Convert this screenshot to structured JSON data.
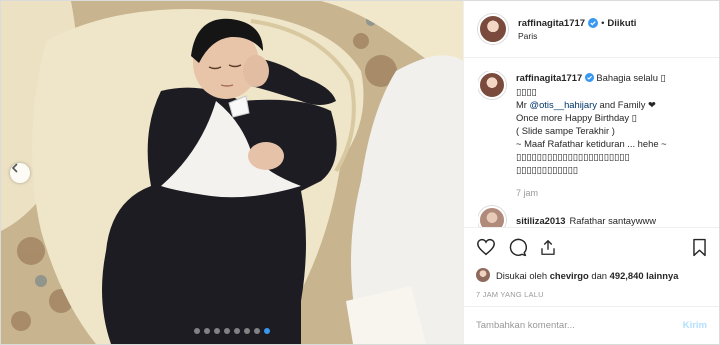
{
  "post": {
    "photo_alt": "",
    "slide_count": 8,
    "active_slide": 8
  },
  "header": {
    "username": "raffinagita1717",
    "separator": "•",
    "follow_status": "Diikuti",
    "location": "Paris"
  },
  "caption": {
    "username": "raffinagita1717",
    "lines": [
      "Bahagia selalu ▯",
      "▯▯▯▯",
      "Mr ",
      "Once more Happy Birthday ▯",
      "( Slide sampe Terakhir )",
      "~ Maaf Rafathar ketiduran ... hehe ~",
      "▯▯▯▯▯▯▯▯▯▯▯▯▯▯▯▯▯▯▯▯▯▯",
      "▯▯▯▯▯▯▯▯▯▯▯▯"
    ],
    "mention": "@otis__hahijary",
    "after_mention": " and Family ❤",
    "time_ago": "7 jam"
  },
  "comment2": {
    "username": "sitiliza2013",
    "text": "Rafathar santaywww"
  },
  "likes": {
    "prefix": "Disukai oleh",
    "user": "chevirgo",
    "joiner": "dan",
    "count": "492,840 lainnya"
  },
  "posted_ago": "7 JAM YANG LALU",
  "comment_box": {
    "placeholder": "Tambahkan komentar...",
    "submit_label": "Kirim"
  },
  "colors": {
    "verified": "#3897f0",
    "dot_active": "#3897f0",
    "submit_disabled": "#b2dffc"
  }
}
